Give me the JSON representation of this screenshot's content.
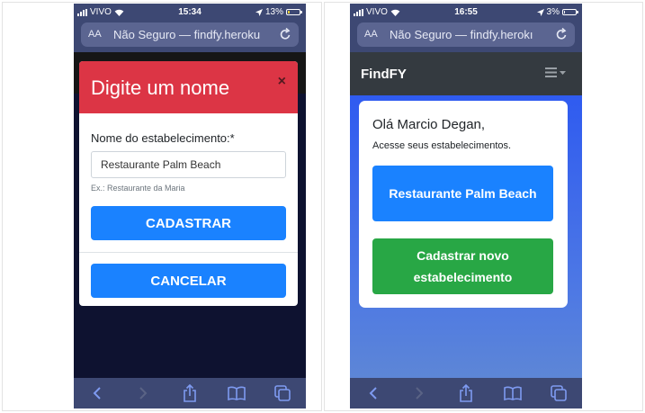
{
  "left_screen": {
    "status": {
      "carrier": "VIVO",
      "time": "15:34",
      "battery": "13%",
      "battery_level": 0.13
    },
    "url_bar": {
      "aa": "AA",
      "url": "Não Seguro — findfy.heroku"
    },
    "modal": {
      "title": "Digite um nome",
      "close": "×",
      "field_label": "Nome do estabelecimento:*",
      "input_value": "Restaurante Palm Beach",
      "hint": "Ex.: Restaurante da Maria",
      "submit_label": "CADASTRAR",
      "cancel_label": "CANCELAR"
    }
  },
  "right_screen": {
    "status": {
      "carrier": "VIVO",
      "time": "16:55",
      "battery": "3%",
      "battery_level": 0.03
    },
    "url_bar": {
      "aa": "AA",
      "url": "Não Seguro — findfy.herokı"
    },
    "navbar": {
      "brand": "FindFY",
      "menu_icon": "hamburger-icon"
    },
    "card": {
      "greeting": "Olá Marcio Degan,",
      "subtitle": "Acesse seus estabelecimentos.",
      "establishment_button": "Restaurante Palm Beach",
      "new_button": "Cadastrar novo estabelecimento"
    }
  },
  "toolbar_icons": [
    "back-icon",
    "forward-icon",
    "share-icon",
    "bookmarks-icon",
    "tabs-icon"
  ],
  "colors": {
    "danger": "#dc3545",
    "primary": "#1a82ff",
    "success": "#28a745",
    "navbar": "#343a40",
    "safari_chrome": "#3d4873"
  }
}
